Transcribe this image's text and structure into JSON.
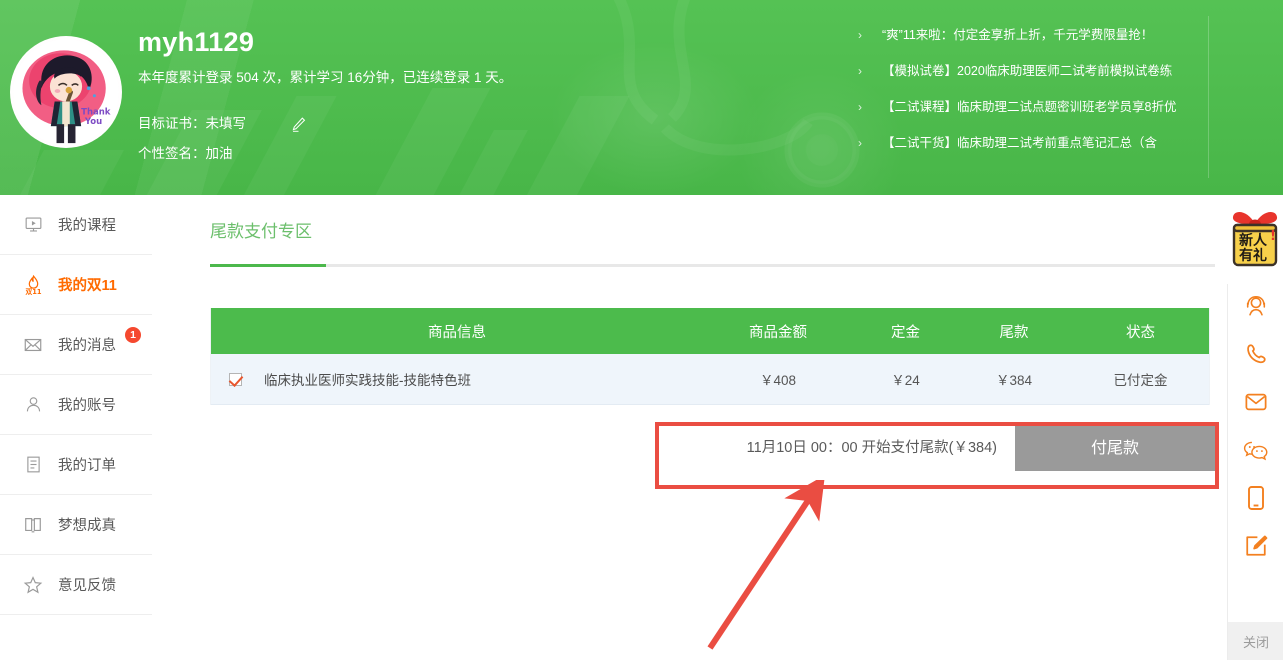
{
  "header": {
    "username": "myh1129",
    "stats_text": "本年度累计登录 504 次，累计学习 16分钟，已连续登录 1 天。",
    "target_cert_label": "目标证书：",
    "target_cert_value": "未填写",
    "signature_label": "个性签名：",
    "signature_value": "加油",
    "edit_icon": "pencil-icon",
    "avatar_alt": "用户头像",
    "news": [
      {
        "arrow": "›",
        "text": "“爽”11来啦：付定金享折上折，千元学费限量抢！"
      },
      {
        "arrow": "›",
        "text": "【模拟试卷】2020临床助理医师二试考前模拟试卷练"
      },
      {
        "arrow": "›",
        "text": "【二试课程】临床助理二试点题密训班老学员享8折优"
      },
      {
        "arrow": "›",
        "text": "【二试干货】临床助理二试考前重点笔记汇总（含"
      }
    ]
  },
  "sidebar": {
    "items": [
      {
        "icon": "monitor-play-icon",
        "label": "我的课程",
        "active": false,
        "badge": ""
      },
      {
        "icon": "flame-double11-icon",
        "label": "我的双11",
        "active": true,
        "badge": ""
      },
      {
        "icon": "envelope-icon",
        "label": "我的消息",
        "active": false,
        "badge": "1"
      },
      {
        "icon": "user-icon",
        "label": "我的账号",
        "active": false,
        "badge": ""
      },
      {
        "icon": "list-document-icon",
        "label": "我的订单",
        "active": false,
        "badge": ""
      },
      {
        "icon": "book-open-icon",
        "label": "梦想成真",
        "active": false,
        "badge": ""
      },
      {
        "icon": "star-icon",
        "label": "意见反馈",
        "active": false,
        "badge": ""
      }
    ]
  },
  "main": {
    "tab_label": "尾款支付专区",
    "table": {
      "headers": [
        "商品信息",
        "商品金额",
        "定金",
        "尾款",
        "状态"
      ],
      "rows": [
        {
          "checked": true,
          "goods": "临床执业医师实践技能-技能特色班",
          "amount": "￥408",
          "deposit": "￥24",
          "final": "￥384",
          "status": "已付定金"
        }
      ]
    },
    "pay_note": "11月10日 00：00 开始支付尾款(￥384)",
    "pay_button": "付尾款"
  },
  "rail": {
    "gift_line1": "新人",
    "gift_line2": "有礼",
    "gift_mark": "!",
    "items": [
      {
        "icon": "headset-service-icon"
      },
      {
        "icon": "phone-icon"
      },
      {
        "icon": "mail-icon"
      },
      {
        "icon": "wechat-icon"
      },
      {
        "icon": "mobile-app-icon"
      },
      {
        "icon": "feedback-pencil-icon"
      }
    ],
    "close_label": "关闭"
  },
  "colors": {
    "brand_green": "#4cbb4c",
    "accent_orange": "#ff6a00",
    "annotation_red": "#ea4d42",
    "row_blue": "#eff5fb",
    "disabled_gray": "#9a9a9a"
  }
}
